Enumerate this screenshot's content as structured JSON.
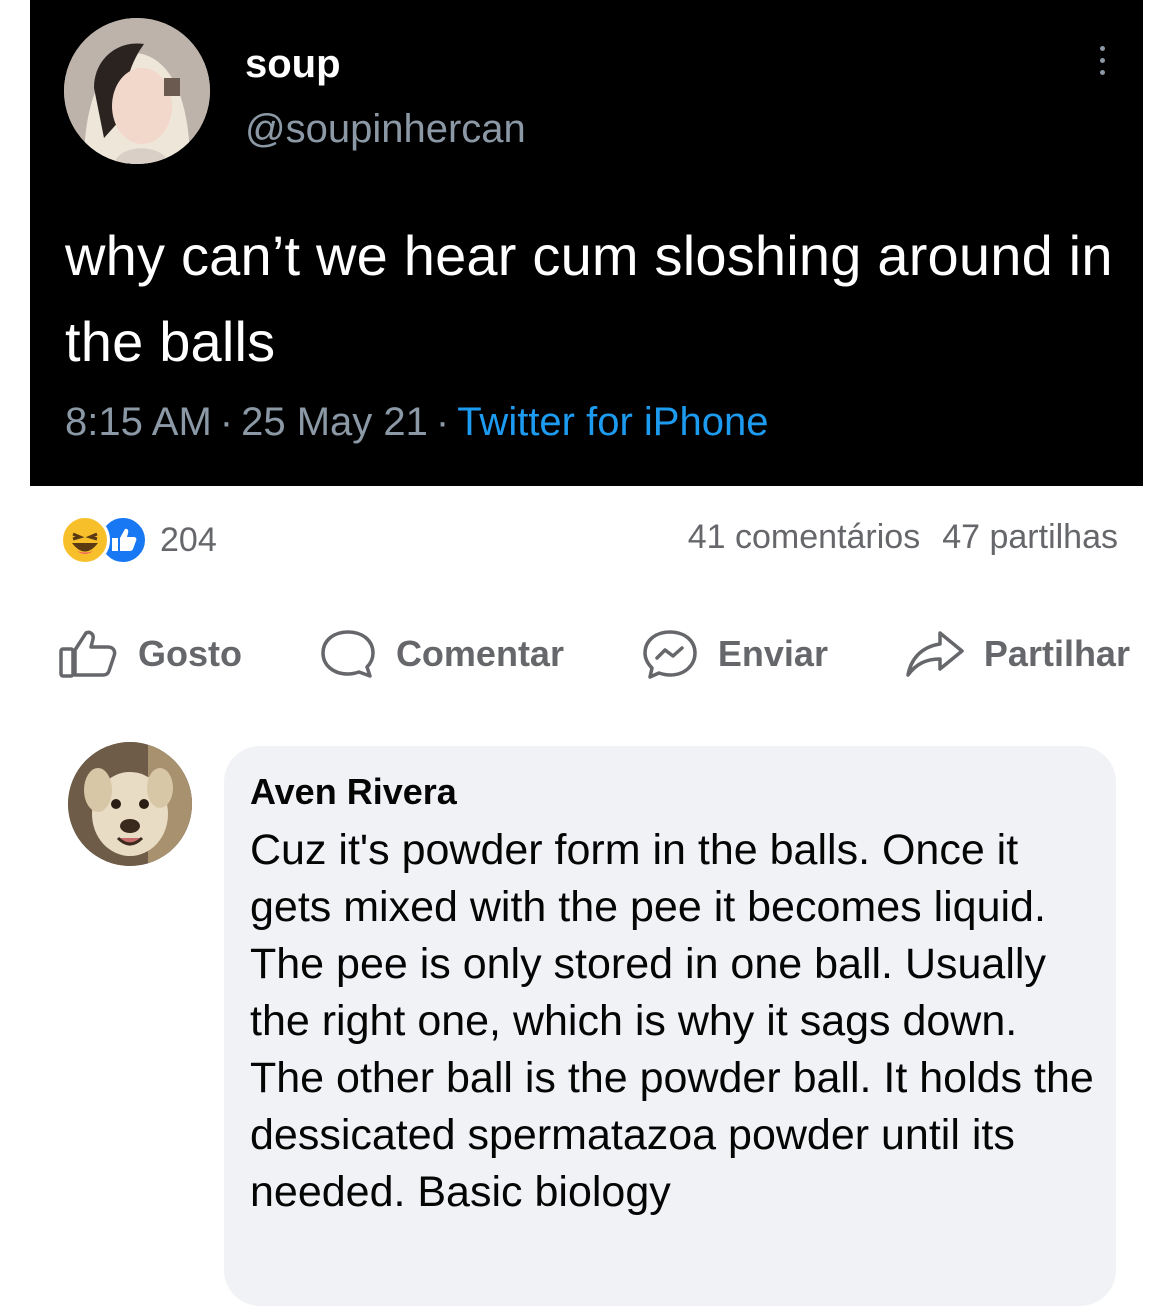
{
  "tweet": {
    "display_name": "soup",
    "handle": "@soupinhercan",
    "text": "why can’t we hear cum sloshing around in the balls",
    "time": "8:15 AM",
    "date": "25 May 21",
    "source": "Twitter for iPhone",
    "separator": "·"
  },
  "reactions": {
    "icons": [
      "haha-reaction-icon",
      "like-reaction-icon"
    ],
    "count": "204"
  },
  "stats": {
    "comments": "41 comentários",
    "shares": "47 partilhas"
  },
  "actions": {
    "like": "Gosto",
    "comment": "Comentar",
    "send": "Enviar",
    "share": "Partilhar"
  },
  "comment": {
    "author": "Aven Rivera",
    "text": "Cuz it's powder form in the balls. Once it gets mixed with the pee it becomes liquid. The pee is only stored in one ball. Usually the right one, which is why it sags down. The other ball is the powder ball. It holds the dessicated spermatazoa powder until its needed. Basic biology"
  },
  "colors": {
    "tweet_bg": "#000000",
    "tweet_meta": "#8b98a5",
    "twitter_blue": "#1d9bf0",
    "fb_grey": "#65676b",
    "bubble_bg": "#f0f2f5",
    "like_blue": "#1877f2",
    "haha_yellow": "#f7c02b"
  }
}
